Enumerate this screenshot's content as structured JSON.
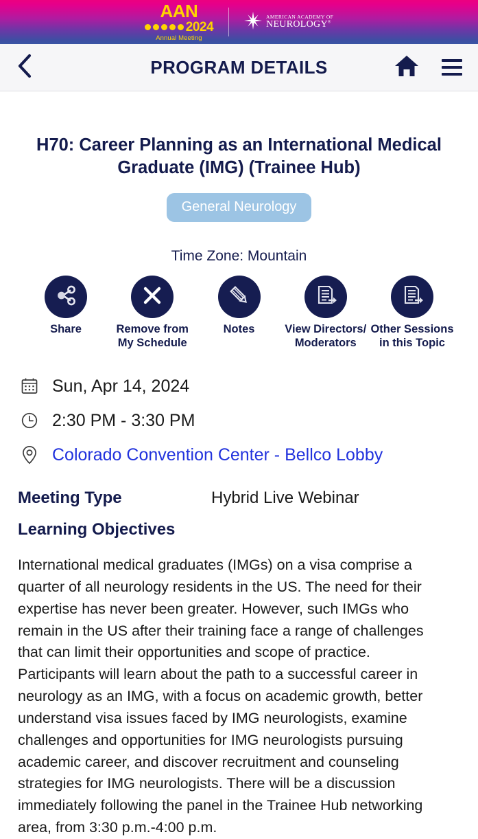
{
  "brand": {
    "aan_word": "AAN",
    "year": "2024",
    "subtitle": "Annual Meeting",
    "dot_count": 5,
    "academy_line1": "AMERICAN ACADEMY OF",
    "academy_line2": "NEUROLOGY",
    "academy_mark": "®",
    "gradient_start": "#ED0080",
    "gradient_end": "#3A55A4",
    "logo_yellow": "#FFD400"
  },
  "navbar": {
    "back_icon": "chevron-left-icon",
    "title": "PROGRAM DETAILS",
    "home_icon": "home-icon",
    "menu_icon": "hamburger-menu-icon",
    "icon_color": "#141B4D",
    "background": "#F6F6F8"
  },
  "session": {
    "title": "H70: Career Planning as an International Medical Graduate (IMG) (Trainee Hub)",
    "topic_badge": "General Neurology",
    "topic_badge_color": "#9CC4E4",
    "time_zone": "Time Zone: Mountain"
  },
  "actions": [
    {
      "label": "Share",
      "icon": "share-nodes-icon"
    },
    {
      "label": "Remove from\nMy Schedule",
      "icon": "close-x-icon"
    },
    {
      "label": "Notes",
      "icon": "pencil-icon"
    },
    {
      "label": "View Directors/\nModerators",
      "icon": "document-arrow-icon"
    },
    {
      "label": "Other Sessions\nin this Topic",
      "icon": "document-arrow-icon"
    }
  ],
  "meta": {
    "date": {
      "icon": "calendar-icon",
      "text": "Sun, Apr 14, 2024"
    },
    "time": {
      "icon": "clock-icon",
      "text": "2:30 PM - 3:30 PM"
    },
    "location": {
      "icon": "map-pin-icon",
      "text": "Colorado Convention Center - Bellco Lobby",
      "link_color": "#2233DD"
    }
  },
  "details": {
    "meeting_type_label": "Meeting Type",
    "meeting_type_value": "Hybrid Live Webinar",
    "learning_objectives_label": "Learning Objectives",
    "learning_objectives_text": "International medical graduates (IMGs) on a visa comprise a quarter of all neurology residents in the US. The need for their expertise has never been greater. However, such IMGs who remain in the US after their training face a range of challenges that can limit their opportunities and scope of practice. Participants will learn about the path to a successful career in neurology as an IMG, with a focus on academic growth, better understand visa issues faced by IMG neurologists, examine challenges and opportunities for IMG neurologists pursuing academic career, and discover recruitment and counseling strategies for IMG neurologists. There will be a discussion immediately following the panel in the Trainee Hub networking area, from 3:30 p.m.-4:00 p.m."
  }
}
